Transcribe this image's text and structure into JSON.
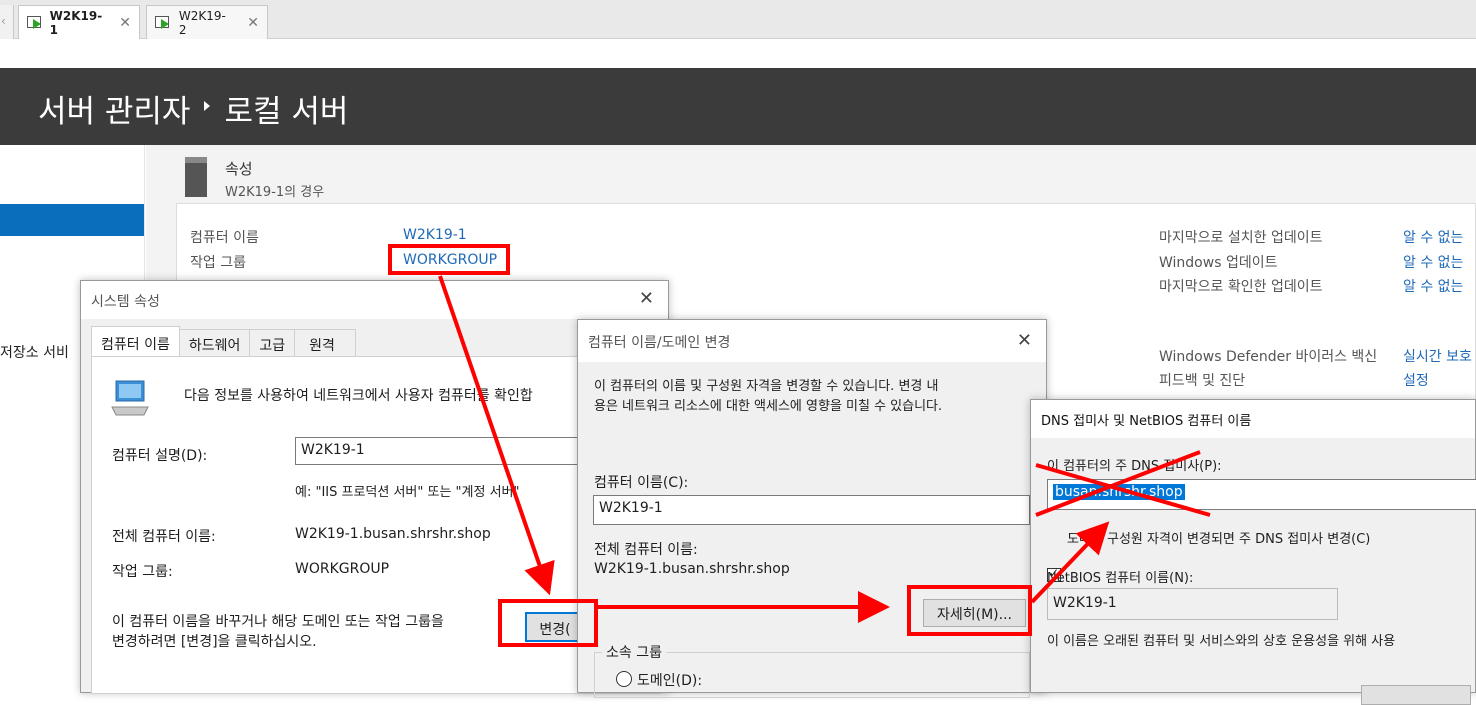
{
  "vm_tabs": [
    {
      "label": "W2K19-1",
      "active": true
    },
    {
      "label": "W2K19-2",
      "active": false
    }
  ],
  "header": {
    "crumb1": "서버 관리자",
    "crumb2": "로컬 서버"
  },
  "sidebar": {
    "partial_item": "저장소 서비"
  },
  "properties": {
    "title": "속성",
    "subtitle": "W2K19-1의 경우",
    "rows_left": [
      {
        "label": "컴퓨터 이름",
        "value": "W2K19-1"
      },
      {
        "label": "작업 그룹",
        "value": "WORKGROUP"
      }
    ],
    "rows_right": [
      {
        "label": "마지막으로 설치한 업데이트",
        "value": "알 수 없는"
      },
      {
        "label": "Windows 업데이트",
        "value": "알 수 없는"
      },
      {
        "label": "마지막으로 확인한 업데이트",
        "value": "알 수 없는"
      },
      {
        "label": "Windows Defender 바이러스 백신",
        "value": "실시간 보호"
      },
      {
        "label": "피드백 및 진단",
        "value": "설정"
      }
    ]
  },
  "system_properties": {
    "title": "시스템 속성",
    "tabs": [
      "컴퓨터 이름",
      "하드웨어",
      "고급",
      "원격"
    ],
    "info_text": "다음 정보를 사용하여 네트워크에서 사용자 컴퓨터를 확인합",
    "desc_label": "컴퓨터 설명(D):",
    "desc_value": "W2K19-1",
    "desc_example": "예: \"IIS 프로덕션 서버\" 또는 \"계정 서버\"",
    "full_name_label": "전체 컴퓨터 이름:",
    "full_name_value": "W2K19-1.busan.shrshr.shop",
    "workgroup_label": "작업 그룹:",
    "workgroup_value": "WORKGROUP",
    "change_text_1": "이 컴퓨터 이름을 바꾸거나 해당 도메인 또는 작업 그룹을",
    "change_text_2": "변경하려면 [변경]을 클릭하십시오.",
    "change_button": "변경("
  },
  "rename_dialog": {
    "title": "컴퓨터 이름/도메인 변경",
    "info_1": "이 컴퓨터의 이름 및 구성원 자격을 변경할 수 있습니다. 변경 내",
    "info_2": "용은 네트워크 리소스에 대한 액세스에 영향을 미칠 수 있습니다.",
    "name_label": "컴퓨터 이름(C):",
    "name_value": "W2K19-1",
    "full_label": "전체 컴퓨터 이름:",
    "full_value": "W2K19-1.busan.shrshr.shop",
    "more_button": "자세히(M)...",
    "member_label": "소속 그룹",
    "domain_radio": "도메인(D):"
  },
  "dns_dialog": {
    "title": "DNS 접미사 및 NetBIOS 컴퓨터 이름",
    "suffix_label": "이 컴퓨터의 주 DNS 접미사(P):",
    "suffix_value": "busan.shrshr.shop",
    "checkbox_label": "도메인 구성원 자격이 변경되면 주 DNS 접미사 변경(C)",
    "netbios_label": "NetBIOS 컴퓨터 이름(N):",
    "netbios_value": "W2K19-1",
    "note": "이 이름은 오래된 컴퓨터 및 서비스와의 상호 운용성을 위해 사용"
  },
  "colors": {
    "header_bg": "#3b3b3b",
    "accent": "#0a6ebd",
    "link": "#1f6ab8",
    "annotation": "#ff0000"
  }
}
